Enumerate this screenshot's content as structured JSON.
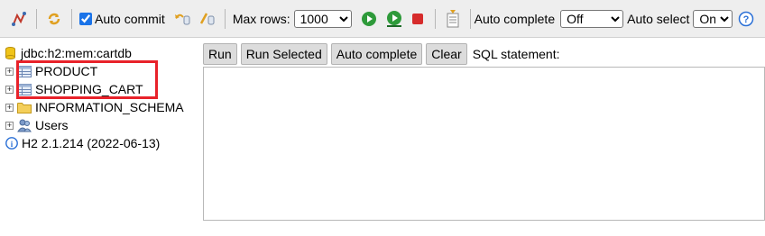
{
  "toolbar": {
    "icons": {
      "disconnect": "disconnect-icon",
      "refresh": "refresh-icon",
      "rollback": "rollback-icon",
      "commit": "commit-icon",
      "run": "run-icon",
      "run_selected": "run-selected-icon",
      "stop": "stop-icon",
      "history": "history-icon",
      "help": "help-icon"
    },
    "auto_commit_label": "Auto commit",
    "auto_commit_checked": true,
    "max_rows_label": "Max rows:",
    "max_rows_value": "1000",
    "auto_complete_label": "Auto complete",
    "auto_complete_value": "Off",
    "auto_select_label": "Auto select",
    "auto_select_value": "On"
  },
  "tree": {
    "connection": "jdbc:h2:mem:cartdb",
    "items": [
      {
        "label": "PRODUCT",
        "icon": "table-icon"
      },
      {
        "label": "SHOPPING_CART",
        "icon": "table-icon"
      },
      {
        "label": "INFORMATION_SCHEMA",
        "icon": "folder-icon"
      },
      {
        "label": "Users",
        "icon": "users-icon"
      }
    ],
    "version": "H2 2.1.214 (2022-06-13)"
  },
  "query": {
    "run": "Run",
    "run_selected": "Run Selected",
    "auto_complete": "Auto complete",
    "clear": "Clear",
    "sql_statement_label": "SQL statement:"
  },
  "colors": {
    "toolbar_bg": "#eeeeee",
    "highlight": "#e8222a",
    "run_green": "#2e9a3a",
    "stop_red": "#d62b2b",
    "help_blue": "#2a6fd6"
  }
}
